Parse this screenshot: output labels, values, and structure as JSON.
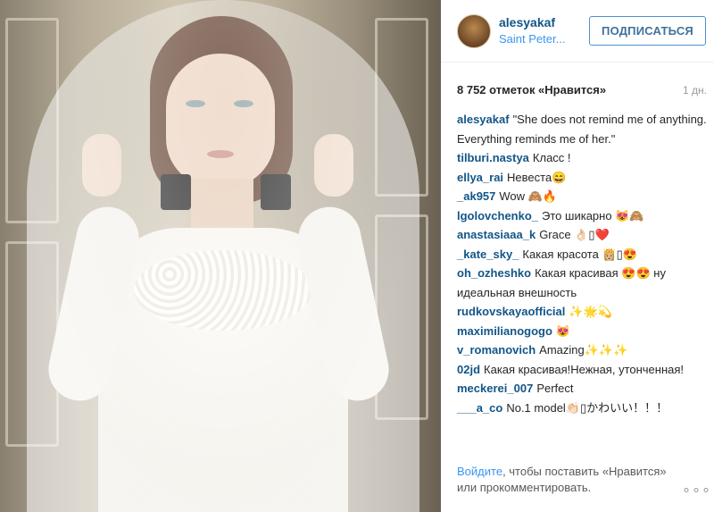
{
  "post": {
    "username": "alesyakaf",
    "location": "Saint Peter...",
    "follow_label": "ПОДПИСАТЬСЯ",
    "likes": "8 752 отметок «Нравится»",
    "time": "1 дн."
  },
  "comments": [
    {
      "user": "alesyakaf",
      "text": "\"She does not remind me of anything. Everything reminds me of her.\""
    },
    {
      "user": "tilburi.nastya",
      "text": "Класс !"
    },
    {
      "user": "ellya_rai",
      "text": "Невеста😄"
    },
    {
      "user": "_ak957",
      "text": "Wow 🙈🔥"
    },
    {
      "user": "lgolovchenko_",
      "text": "Это шикарно 😻🙈"
    },
    {
      "user": "anastasiaaa_k",
      "text": "Grace 👌🏻▯❤️"
    },
    {
      "user": "_kate_sky_",
      "text": "Какая красота 👸🏼▯😍"
    },
    {
      "user": "oh_ozheshko",
      "text": "Какая красивая 😍😍 ну идеальная внешность"
    },
    {
      "user": "rudkovskayaofficial",
      "text": "✨🌟💫"
    },
    {
      "user": "maximilianogogo",
      "text": "😻"
    },
    {
      "user": "v_romanovich",
      "text": "Amazing✨✨✨"
    },
    {
      "user": "02jd",
      "text": "Какая красивая!Нежная, утонченная!"
    },
    {
      "user": "meckerei_007",
      "text": "Perfect"
    },
    {
      "user": "___a_co",
      "text": "No.1 model👏🏻▯かわいい！！！"
    }
  ],
  "footer": {
    "login": "Войдите",
    "rest": ", чтобы поставить «Нравится» или прокомментировать.",
    "more": "∘∘∘"
  },
  "icons": {
    "avatar": "user-avatar",
    "more": "more-options-icon"
  },
  "colors": {
    "username": "#125688",
    "link": "#3897f0",
    "button_border": "#4e8fd2"
  }
}
